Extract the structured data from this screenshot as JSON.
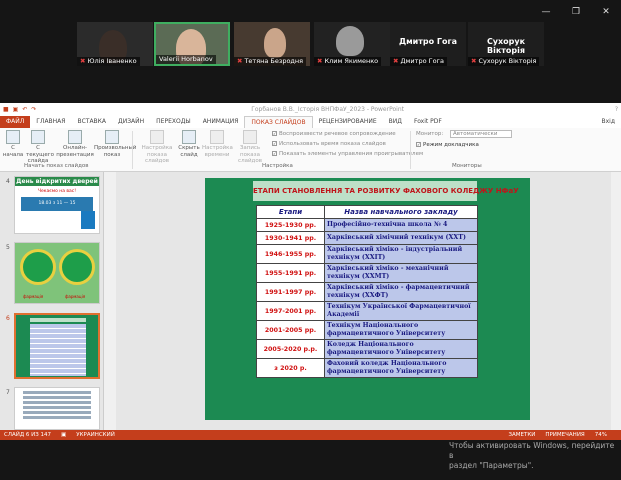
{
  "window": {
    "minimize": "—",
    "restore": "❐",
    "close": "✕"
  },
  "participants": [
    {
      "name": "Юлія Іваненко",
      "type": "video"
    },
    {
      "name": "Valerii Horbanov",
      "type": "video",
      "active": true
    },
    {
      "name": "Тетяна Безродня",
      "type": "video"
    },
    {
      "name": "Клим Якименко",
      "type": "video"
    },
    {
      "name": "Дмитро Гога",
      "type": "name",
      "big": "Дмитро Гога"
    },
    {
      "name": "Сухорук Вікторія",
      "type": "name",
      "big": "Сухорук Вікторія"
    }
  ],
  "ppt": {
    "doc_title": "Горбанов В.В._Історія ВНПФаУ_2023 - PowerPoint",
    "help": "?",
    "tabs": [
      "ФАЙЛ",
      "ГЛАВНАЯ",
      "ВСТАВКА",
      "ДИЗАЙН",
      "ПЕРЕХОДЫ",
      "АНИМАЦИЯ",
      "ПОКАЗ СЛАЙДОВ",
      "РЕЦЕНЗИРОВАНИЕ",
      "ВИД",
      "Foxit PDF"
    ],
    "tab_right": "Вхід",
    "ribbon": {
      "b1": "С начала",
      "b2": "С текущего слайда",
      "b3": "Онлайн-презентация",
      "b4": "Произвольный показ",
      "g1": "Начать показ слайдов",
      "b5": "Настройка показа слайдов",
      "b6": "Скрыть слайд",
      "b7": "Настройка времени",
      "b8": "Запись показа слайдов",
      "c1": "Воспроизвести речевое сопровождение",
      "c2": "Использовать время показа слайдов",
      "c3": "Показать элементы управления проигрывателем",
      "g2": "Настройка",
      "mon_label": "Монитор:",
      "mon_value": "Автоматически",
      "presenter": "Режим докладчика",
      "g3": "Мониторы"
    },
    "status": {
      "slide": "СЛАЙД 6 ИЗ 147",
      "lang": "УКРАИНСКИЙ",
      "notes": "ЗАМЕТКИ",
      "comments": "ПРИМЕЧАНИЯ",
      "zoom": "74%"
    }
  },
  "thumbs": [
    {
      "num": "4",
      "title": "День відкритих дверей",
      "sub": "Чекаємо на вас!",
      "info": "18.03 з 11 — 15"
    },
    {
      "num": "5",
      "cap1": "фармація",
      "cap2": "фармація"
    },
    {
      "num": "6"
    },
    {
      "num": "7"
    }
  ],
  "slide": {
    "title": "ЕТАПИ СТАНОВЛЕННЯ ТА РОЗВИТКУ ФАХОВОГО КОЛЕДЖУ НФаУ",
    "col1": "Етапи",
    "col2": "Назва навчального закладу",
    "rows": [
      {
        "y": "1925-1930 рр.",
        "n": "Професійно-технічна школа № 4"
      },
      {
        "y": "1930-1941 рр.",
        "n": "Харківський хімічний технікум (ХХТ)"
      },
      {
        "y": "1946-1955 рр.",
        "n": "Харківський хіміко - індустріальний технікум (ХХІТ)"
      },
      {
        "y": "1955-1991 рр.",
        "n": "Харківський хіміко - механічний технікум (ХХМТ)"
      },
      {
        "y": "1991-1997 рр.",
        "n": "Харківський хіміко - фармацевтичний технікум (ХХФТ)"
      },
      {
        "y": "1997-2001 рр.",
        "n": "Технікум Української Фармацевтичної Академії"
      },
      {
        "y": "2001-2005 рр.",
        "n": "Технікум Національного фармацевтичного Університету"
      },
      {
        "y": "2005-2020 р.р.",
        "n": "Коледж Національного фармацевтичного Університету"
      },
      {
        "y": "з 2020 р.",
        "n": "Фаховий коледж Національного фармацевтичного Університету"
      }
    ]
  },
  "activation": {
    "l1": "Чтобы активировать Windows, перейдите в",
    "l2": "раздел \"Параметры\"."
  }
}
